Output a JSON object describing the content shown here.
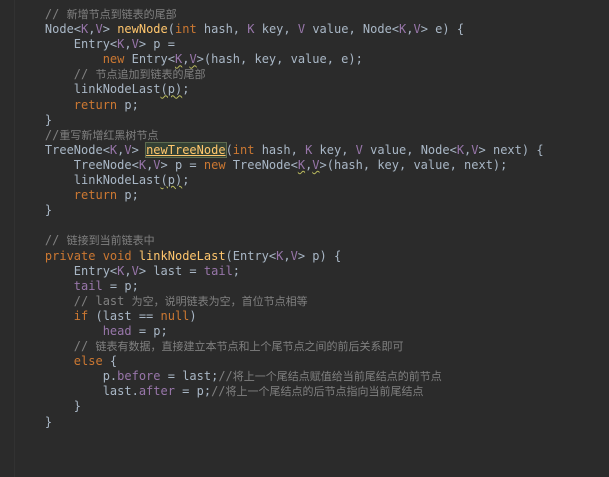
{
  "lines": [
    [
      {
        "t": "    // ",
        "c": "cm"
      },
      {
        "t": "新增节点到链表的尾部",
        "c": "cm cjk"
      }
    ],
    [
      {
        "t": "    Node<",
        "c": "tx"
      },
      {
        "t": "K",
        "c": "tp"
      },
      {
        "t": ",",
        "c": "tx"
      },
      {
        "t": "V",
        "c": "tp"
      },
      {
        "t": "> ",
        "c": "tx"
      },
      {
        "t": "newNode",
        "c": "fn"
      },
      {
        "t": "(",
        "c": "tx"
      },
      {
        "t": "int",
        "c": "kw"
      },
      {
        "t": " hash, ",
        "c": "tx"
      },
      {
        "t": "K",
        "c": "tp"
      },
      {
        "t": " key, ",
        "c": "tx"
      },
      {
        "t": "V",
        "c": "tp"
      },
      {
        "t": " value, Node<",
        "c": "tx"
      },
      {
        "t": "K",
        "c": "tp"
      },
      {
        "t": ",",
        "c": "tx"
      },
      {
        "t": "V",
        "c": "tp"
      },
      {
        "t": "> e) {",
        "c": "tx"
      }
    ],
    [
      {
        "t": "        Entry<",
        "c": "tx"
      },
      {
        "t": "K",
        "c": "tp"
      },
      {
        "t": ",",
        "c": "tx"
      },
      {
        "t": "V",
        "c": "tp"
      },
      {
        "t": "> p =",
        "c": "tx"
      }
    ],
    [
      {
        "t": "            ",
        "c": "tx"
      },
      {
        "t": "new",
        "c": "kw"
      },
      {
        "t": " Entry<",
        "c": "tx"
      },
      {
        "t": "K",
        "c": "tp wavy"
      },
      {
        "t": ",",
        "c": "tx"
      },
      {
        "t": "V",
        "c": "tp wavy"
      },
      {
        "t": ">(hash, key, value, e);",
        "c": "tx"
      }
    ],
    [
      {
        "t": "        // ",
        "c": "cm"
      },
      {
        "t": "节点追加到链表的尾部",
        "c": "cm cjk"
      }
    ],
    [
      {
        "t": "        linkNodeLast",
        "c": "tx"
      },
      {
        "t": "(p)",
        "c": "tx wavy"
      },
      {
        "t": ";",
        "c": "tx"
      }
    ],
    [
      {
        "t": "        ",
        "c": "tx"
      },
      {
        "t": "return",
        "c": "kw"
      },
      {
        "t": " p;",
        "c": "tx"
      }
    ],
    [
      {
        "t": "    }",
        "c": "tx"
      }
    ],
    [
      {
        "t": "    //",
        "c": "cm"
      },
      {
        "t": "重写新增红黑树节点",
        "c": "cm cjk"
      }
    ],
    [
      {
        "t": "    TreeNode<",
        "c": "tx"
      },
      {
        "t": "K",
        "c": "tp"
      },
      {
        "t": ",",
        "c": "tx"
      },
      {
        "t": "V",
        "c": "tp"
      },
      {
        "t": "> ",
        "c": "tx"
      },
      {
        "t": "newTreeNode",
        "c": "hl"
      },
      {
        "t": "(",
        "c": "tx"
      },
      {
        "t": "int",
        "c": "kw"
      },
      {
        "t": " hash, ",
        "c": "tx"
      },
      {
        "t": "K",
        "c": "tp"
      },
      {
        "t": " key, ",
        "c": "tx"
      },
      {
        "t": "V",
        "c": "tp"
      },
      {
        "t": " value, Node<",
        "c": "tx"
      },
      {
        "t": "K",
        "c": "tp"
      },
      {
        "t": ",",
        "c": "tx"
      },
      {
        "t": "V",
        "c": "tp"
      },
      {
        "t": "> next) {",
        "c": "tx"
      }
    ],
    [
      {
        "t": "        TreeNode<",
        "c": "tx"
      },
      {
        "t": "K",
        "c": "tp"
      },
      {
        "t": ",",
        "c": "tx"
      },
      {
        "t": "V",
        "c": "tp"
      },
      {
        "t": "> p = ",
        "c": "tx"
      },
      {
        "t": "new",
        "c": "kw"
      },
      {
        "t": " TreeNode<",
        "c": "tx"
      },
      {
        "t": "K",
        "c": "tp wavy"
      },
      {
        "t": ",",
        "c": "tx"
      },
      {
        "t": "V",
        "c": "tp wavy"
      },
      {
        "t": ">(hash, key, value, next);",
        "c": "tx"
      }
    ],
    [
      {
        "t": "        linkNodeLast",
        "c": "tx"
      },
      {
        "t": "(p)",
        "c": "tx wavy"
      },
      {
        "t": ";",
        "c": "tx"
      }
    ],
    [
      {
        "t": "        ",
        "c": "tx"
      },
      {
        "t": "return",
        "c": "kw"
      },
      {
        "t": " p;",
        "c": "tx"
      }
    ],
    [
      {
        "t": "    }",
        "c": "tx"
      }
    ],
    [],
    [
      {
        "t": "    // ",
        "c": "cm"
      },
      {
        "t": "链接到当前链表中",
        "c": "cm cjk"
      }
    ],
    [
      {
        "t": "    ",
        "c": "tx"
      },
      {
        "t": "private void",
        "c": "kw"
      },
      {
        "t": " ",
        "c": "tx"
      },
      {
        "t": "linkNodeLast",
        "c": "fn"
      },
      {
        "t": "(Entry<",
        "c": "tx"
      },
      {
        "t": "K",
        "c": "tp"
      },
      {
        "t": ",",
        "c": "tx"
      },
      {
        "t": "V",
        "c": "tp"
      },
      {
        "t": "> p) {",
        "c": "tx"
      }
    ],
    [
      {
        "t": "        Entry<",
        "c": "tx"
      },
      {
        "t": "K",
        "c": "tp"
      },
      {
        "t": ",",
        "c": "tx"
      },
      {
        "t": "V",
        "c": "tp"
      },
      {
        "t": "> last = ",
        "c": "tx"
      },
      {
        "t": "tail",
        "c": "fd"
      },
      {
        "t": ";",
        "c": "tx"
      }
    ],
    [
      {
        "t": "        ",
        "c": "tx"
      },
      {
        "t": "tail",
        "c": "fd"
      },
      {
        "t": " = p;",
        "c": "tx"
      }
    ],
    [
      {
        "t": "        // last ",
        "c": "cm"
      },
      {
        "t": "为空，说明链表为空，首位节点相等",
        "c": "cm cjk"
      }
    ],
    [
      {
        "t": "        ",
        "c": "tx"
      },
      {
        "t": "if",
        "c": "kw"
      },
      {
        "t": " (last == ",
        "c": "tx"
      },
      {
        "t": "null",
        "c": "kw"
      },
      {
        "t": ")",
        "c": "tx"
      }
    ],
    [
      {
        "t": "            ",
        "c": "tx"
      },
      {
        "t": "head",
        "c": "fd"
      },
      {
        "t": " = p;",
        "c": "tx"
      }
    ],
    [
      {
        "t": "        // ",
        "c": "cm"
      },
      {
        "t": "链表有数据，直接建立本节点和上个尾节点之间的前后关系即可",
        "c": "cm cjk"
      }
    ],
    [
      {
        "t": "        ",
        "c": "tx"
      },
      {
        "t": "else",
        "c": "kw"
      },
      {
        "t": " {",
        "c": "tx"
      }
    ],
    [
      {
        "t": "            p.",
        "c": "tx"
      },
      {
        "t": "before",
        "c": "fd"
      },
      {
        "t": " = last;",
        "c": "tx"
      },
      {
        "t": "//",
        "c": "cm"
      },
      {
        "t": "将上一个尾结点赋值给当前尾结点的前节点",
        "c": "cm cjk"
      }
    ],
    [
      {
        "t": "            last.",
        "c": "tx"
      },
      {
        "t": "after",
        "c": "fd"
      },
      {
        "t": " = p;",
        "c": "tx"
      },
      {
        "t": "//",
        "c": "cm"
      },
      {
        "t": "将上一个尾结点的后节点指向当前尾结点",
        "c": "cm cjk"
      }
    ],
    [
      {
        "t": "        }",
        "c": "tx"
      }
    ],
    [
      {
        "t": "    }",
        "c": "tx"
      }
    ]
  ],
  "highlight_color": "#344134",
  "keyword_color": "#cc7832",
  "function_color": "#ffc66d",
  "type_param_color": "#9876aa",
  "comment_color": "#808080",
  "background_color": "#2b2b2b"
}
